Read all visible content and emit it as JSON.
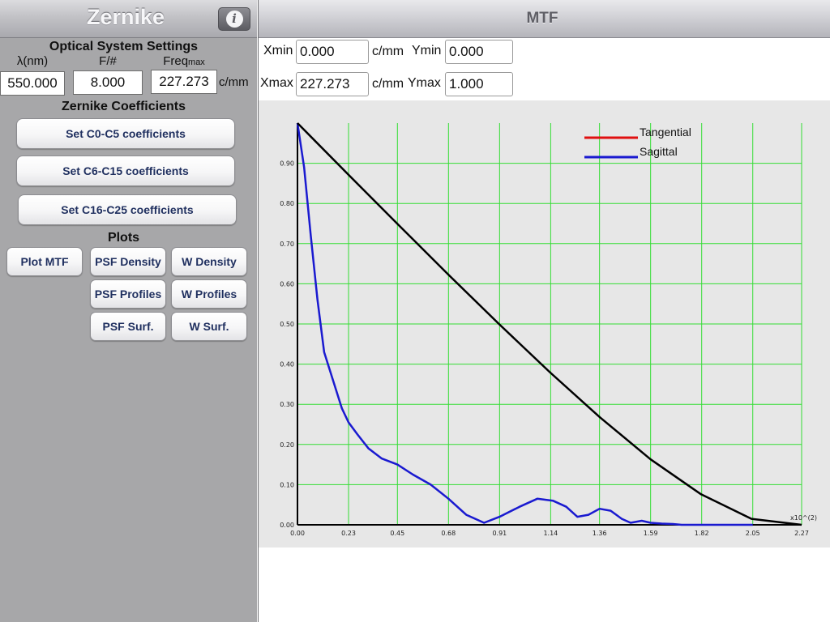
{
  "app": {
    "title": "Zernike",
    "info_icon": "info-icon"
  },
  "settings": {
    "heading": "Optical System Settings",
    "wavelength": {
      "label": "λ(nm)",
      "value": "550.000"
    },
    "fnumber": {
      "label": "F/#",
      "value": "8.000"
    },
    "freq_max": {
      "label": "Freq",
      "label_sub": "max",
      "value": "227.273",
      "unit": "c/mm"
    }
  },
  "coefficients": {
    "heading": "Zernike Coefficients",
    "buttons": [
      "Set C0-C5 coefficients",
      "Set C6-C15 coefficients",
      "Set C16-C25 coefficients"
    ]
  },
  "plots": {
    "heading": "Plots",
    "buttons": [
      "Plot MTF",
      "PSF Density",
      "W Density",
      "PSF Profiles",
      "W Profiles",
      "PSF Surf.",
      "W Surf."
    ]
  },
  "plot_panel": {
    "title": "MTF",
    "xmin": {
      "label": "Xmin",
      "value": "0.000",
      "unit": "c/mm"
    },
    "ymin": {
      "label": "Ymin",
      "value": "0.000"
    },
    "xmax": {
      "label": "Xmax",
      "value": "227.273",
      "unit": "c/mm"
    },
    "ymax": {
      "label": "Ymax",
      "value": "1.000"
    }
  },
  "chart_data": {
    "type": "line",
    "title": "",
    "xlabel": "",
    "ylabel": "",
    "x_multiplier_label": "x10^(2)",
    "xlim": [
      0,
      2.27
    ],
    "ylim": [
      0,
      1.0
    ],
    "x_ticks": [
      "0.00",
      "0.23",
      "0.45",
      "0.68",
      "0.91",
      "1.14",
      "1.36",
      "1.59",
      "1.82",
      "2.05",
      "2.27"
    ],
    "y_ticks": [
      "0.00",
      "0.10",
      "0.20",
      "0.30",
      "0.40",
      "0.50",
      "0.60",
      "0.70",
      "0.80",
      "0.90"
    ],
    "grid": true,
    "legend_position": "top-right",
    "series": [
      {
        "name": "Tangential",
        "color": "#e01010",
        "x": [],
        "y": []
      },
      {
        "name": "Sagittal",
        "color": "#1a1ad0",
        "x": [
          0,
          0.03,
          0.06,
          0.09,
          0.12,
          0.16,
          0.2,
          0.23,
          0.27,
          0.32,
          0.38,
          0.45,
          0.52,
          0.6,
          0.68,
          0.76,
          0.84,
          0.91,
          1.0,
          1.08,
          1.15,
          1.21,
          1.26,
          1.31,
          1.36,
          1.41,
          1.46,
          1.5,
          1.55,
          1.59,
          1.64,
          1.69,
          1.73,
          1.77,
          1.82,
          1.87,
          1.91,
          1.96,
          2.01,
          2.05
        ],
        "y": [
          1.0,
          0.89,
          0.72,
          0.56,
          0.43,
          0.36,
          0.29,
          0.255,
          0.225,
          0.19,
          0.165,
          0.15,
          0.125,
          0.1,
          0.065,
          0.025,
          0.005,
          0.02,
          0.045,
          0.065,
          0.06,
          0.045,
          0.02,
          0.025,
          0.04,
          0.035,
          0.015,
          0.005,
          0.01,
          0.005,
          0.003,
          0.002,
          0.0,
          0.0,
          0.0,
          0.0,
          0.0,
          0.0,
          0.0,
          0.0
        ]
      },
      {
        "name": "",
        "color": "#000000",
        "x": [
          0,
          0.227,
          0.454,
          0.681,
          0.909,
          1.136,
          1.363,
          1.59,
          1.817,
          2.044,
          2.27
        ],
        "y": [
          1.0,
          0.873,
          0.747,
          0.622,
          0.499,
          0.38,
          0.267,
          0.163,
          0.076,
          0.015,
          0.0
        ]
      }
    ]
  }
}
